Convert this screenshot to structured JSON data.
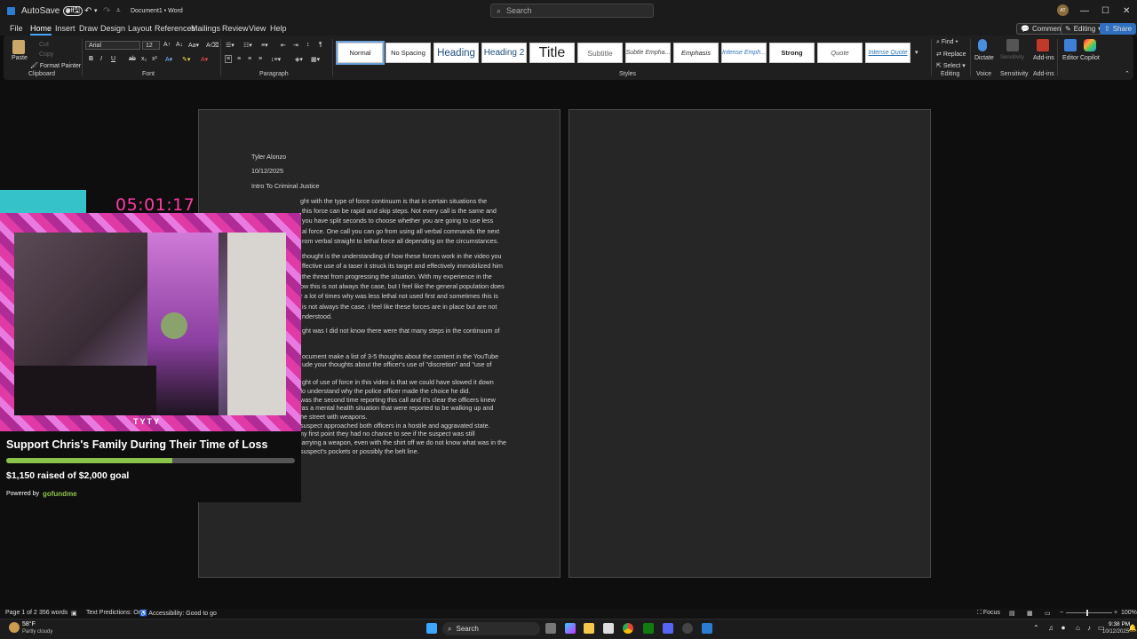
{
  "titlebar": {
    "autosave_label": "AutoSave",
    "autosave_state": "Off",
    "document_title": "Document1 • Word",
    "search_placeholder": "Search",
    "avatar_initials": "AT"
  },
  "menu": {
    "tabs": [
      "File",
      "Home",
      "Insert",
      "Draw",
      "Design",
      "Layout",
      "References",
      "Mailings",
      "Review",
      "View",
      "Help"
    ],
    "active_tab": "Home",
    "comments_label": "Comments",
    "editing_label": "Editing",
    "share_label": "Share"
  },
  "ribbon": {
    "clipboard": {
      "paste": "Paste",
      "cut": "Cut",
      "copy": "Copy",
      "format_painter": "Format Painter",
      "group_label": "Clipboard"
    },
    "font": {
      "family": "Arial",
      "size": "12",
      "group_label": "Font"
    },
    "paragraph": {
      "group_label": "Paragraph"
    },
    "styles": {
      "items": [
        "Normal",
        "No Spacing",
        "Heading",
        "Heading 2",
        "Title",
        "Subtitle",
        "Subtle Empha...",
        "Emphasis",
        "Intense Emph...",
        "Strong",
        "Quote",
        "Intense Quote"
      ],
      "group_label": "Styles"
    },
    "editing": {
      "find": "Find",
      "replace": "Replace",
      "select": "Select",
      "group_label": "Editing"
    },
    "voice": {
      "dictate": "Dictate",
      "group_label": "Voice"
    },
    "sensitivity": {
      "label": "Sensitivity",
      "group_label": "Sensitivity"
    },
    "addins": {
      "label": "Add-ins",
      "group_label": "Add-ins"
    },
    "editor": {
      "label": "Editor"
    },
    "copilot": {
      "label": "Copilot"
    }
  },
  "document": {
    "header_lines": [
      "Tyler Alonzo",
      "10/12/2025",
      "Intro To Criminal Justice"
    ],
    "body_lines": [
      "ght with the type of force continuum is that in certain situations the",
      "this force can be rapid and skip steps. Not every call is the same and",
      "you have split seconds to choose whether you are going to use less",
      "al force. One call you can go from using all verbal commands the next",
      "rom verbal straight to lethal force all depending on the circumstances.",
      "thought is the understanding of how these forces work in the video you",
      "ffective use of a taser it struck its target and effectively immobilized him",
      "the threat from progressing the situation. With my experience in the",
      "ow this is not always the case, but I feel like the general population does",
      "r a lot of times why was less lethal not used first and sometimes this is",
      "is not always the case. I feel like these forces are in place but are not",
      "nderstood.",
      "ght was I did not know there were that many steps in the continuum of",
      "ocument make a list of 3-5 thoughts about the content in the YouTube",
      "ude your thoughts about the officer's use of \"discretion\" and \"use of",
      "ght of use of force in this video is that we could have slowed it down",
      "do understand why the police officer made the choice he did.",
      "was the second time reporting this call and it's clear the officers knew",
      "vas a mental health situation that were reported to be walking up and",
      " the street with weapons.",
      "suspect approached both officers in a hostile and aggravated state.",
      " my first point they had no chance to see if the suspect was still",
      "carrying a weapon, even with the shirt off we do not know what was in the",
      "suspect's pockets or possibly the belt line."
    ]
  },
  "overlay": {
    "timer": "05:01:17",
    "cam_caption": "TYTY",
    "fund_title": "Support Chris's Family During Their Time of Loss",
    "fund_progress": 0.575,
    "fund_raised": "$1,150 raised of $2,000 goal",
    "powered_by": "Powered by",
    "powered_brand": "gofundme"
  },
  "status": {
    "page": "Page 1 of 2",
    "words": "356 words",
    "text_predictions": "Text Predictions: On",
    "accessibility": "Accessibility: Good to go",
    "focus": "Focus",
    "zoom": "100%"
  },
  "taskbar": {
    "weather_temp": "58°F",
    "weather_desc": "Partly cloudy",
    "search_label": "Search",
    "time": "9:38 PM",
    "date": "10/12/2025"
  }
}
